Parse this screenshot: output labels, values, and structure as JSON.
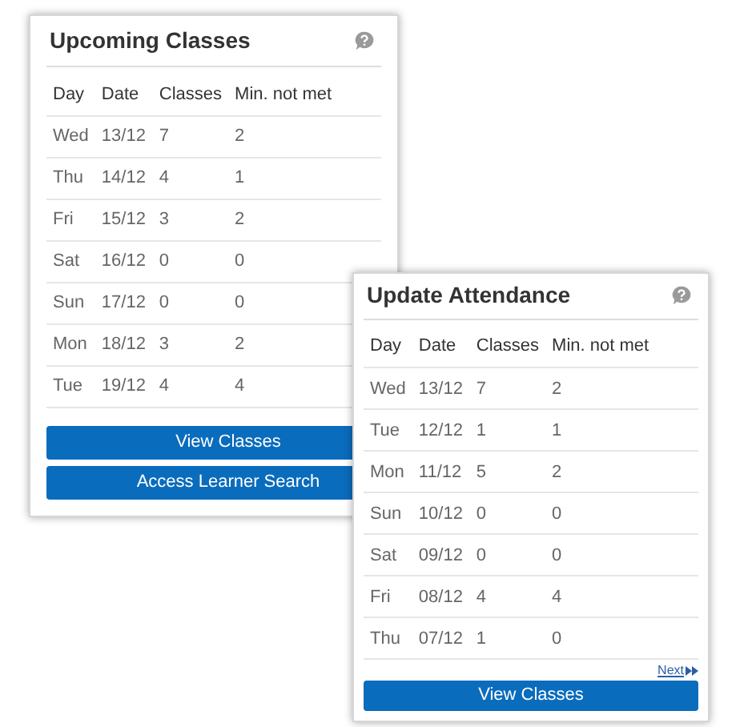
{
  "panels": [
    {
      "title": "Upcoming Classes",
      "columns": [
        "Day",
        "Date",
        "Classes",
        "Min. not met"
      ],
      "rows": [
        [
          "Wed",
          "13/12",
          "7",
          "2"
        ],
        [
          "Thu",
          "14/12",
          "4",
          "1"
        ],
        [
          "Fri",
          "15/12",
          "3",
          "2"
        ],
        [
          "Sat",
          "16/12",
          "0",
          "0"
        ],
        [
          "Sun",
          "17/12",
          "0",
          "0"
        ],
        [
          "Mon",
          "18/12",
          "3",
          "2"
        ],
        [
          "Tue",
          "19/12",
          "4",
          "4"
        ]
      ],
      "buttons": [
        "View Classes",
        "Access Learner Search"
      ]
    },
    {
      "title": "Update Attendance",
      "columns": [
        "Day",
        "Date",
        "Classes",
        "Min. not met"
      ],
      "rows": [
        [
          "Wed",
          "13/12",
          "7",
          "2"
        ],
        [
          "Tue",
          "12/12",
          "1",
          "1"
        ],
        [
          "Mon",
          "11/12",
          "5",
          "2"
        ],
        [
          "Sun",
          "10/12",
          "0",
          "0"
        ],
        [
          "Sat",
          "09/12",
          "0",
          "0"
        ],
        [
          "Fri",
          "08/12",
          "4",
          "4"
        ],
        [
          "Thu",
          "07/12",
          "1",
          "0"
        ]
      ],
      "next_link": "Next",
      "buttons": [
        "View Classes"
      ]
    }
  ]
}
